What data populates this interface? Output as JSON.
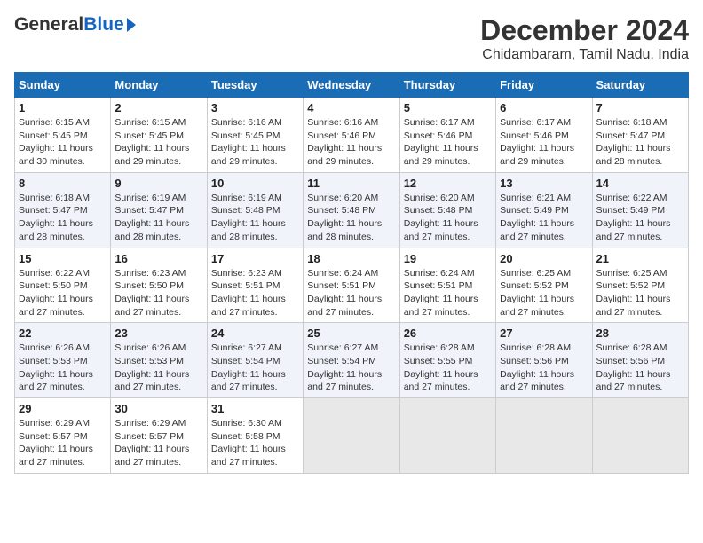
{
  "logo": {
    "general": "General",
    "blue": "Blue"
  },
  "title": "December 2024",
  "subtitle": "Chidambaram, Tamil Nadu, India",
  "days_of_week": [
    "Sunday",
    "Monday",
    "Tuesday",
    "Wednesday",
    "Thursday",
    "Friday",
    "Saturday"
  ],
  "weeks": [
    [
      {
        "day": "1",
        "info": "Sunrise: 6:15 AM\nSunset: 5:45 PM\nDaylight: 11 hours\nand 30 minutes."
      },
      {
        "day": "2",
        "info": "Sunrise: 6:15 AM\nSunset: 5:45 PM\nDaylight: 11 hours\nand 29 minutes."
      },
      {
        "day": "3",
        "info": "Sunrise: 6:16 AM\nSunset: 5:45 PM\nDaylight: 11 hours\nand 29 minutes."
      },
      {
        "day": "4",
        "info": "Sunrise: 6:16 AM\nSunset: 5:46 PM\nDaylight: 11 hours\nand 29 minutes."
      },
      {
        "day": "5",
        "info": "Sunrise: 6:17 AM\nSunset: 5:46 PM\nDaylight: 11 hours\nand 29 minutes."
      },
      {
        "day": "6",
        "info": "Sunrise: 6:17 AM\nSunset: 5:46 PM\nDaylight: 11 hours\nand 29 minutes."
      },
      {
        "day": "7",
        "info": "Sunrise: 6:18 AM\nSunset: 5:47 PM\nDaylight: 11 hours\nand 28 minutes."
      }
    ],
    [
      {
        "day": "8",
        "info": "Sunrise: 6:18 AM\nSunset: 5:47 PM\nDaylight: 11 hours\nand 28 minutes."
      },
      {
        "day": "9",
        "info": "Sunrise: 6:19 AM\nSunset: 5:47 PM\nDaylight: 11 hours\nand 28 minutes."
      },
      {
        "day": "10",
        "info": "Sunrise: 6:19 AM\nSunset: 5:48 PM\nDaylight: 11 hours\nand 28 minutes."
      },
      {
        "day": "11",
        "info": "Sunrise: 6:20 AM\nSunset: 5:48 PM\nDaylight: 11 hours\nand 28 minutes."
      },
      {
        "day": "12",
        "info": "Sunrise: 6:20 AM\nSunset: 5:48 PM\nDaylight: 11 hours\nand 27 minutes."
      },
      {
        "day": "13",
        "info": "Sunrise: 6:21 AM\nSunset: 5:49 PM\nDaylight: 11 hours\nand 27 minutes."
      },
      {
        "day": "14",
        "info": "Sunrise: 6:22 AM\nSunset: 5:49 PM\nDaylight: 11 hours\nand 27 minutes."
      }
    ],
    [
      {
        "day": "15",
        "info": "Sunrise: 6:22 AM\nSunset: 5:50 PM\nDaylight: 11 hours\nand 27 minutes."
      },
      {
        "day": "16",
        "info": "Sunrise: 6:23 AM\nSunset: 5:50 PM\nDaylight: 11 hours\nand 27 minutes."
      },
      {
        "day": "17",
        "info": "Sunrise: 6:23 AM\nSunset: 5:51 PM\nDaylight: 11 hours\nand 27 minutes."
      },
      {
        "day": "18",
        "info": "Sunrise: 6:24 AM\nSunset: 5:51 PM\nDaylight: 11 hours\nand 27 minutes."
      },
      {
        "day": "19",
        "info": "Sunrise: 6:24 AM\nSunset: 5:51 PM\nDaylight: 11 hours\nand 27 minutes."
      },
      {
        "day": "20",
        "info": "Sunrise: 6:25 AM\nSunset: 5:52 PM\nDaylight: 11 hours\nand 27 minutes."
      },
      {
        "day": "21",
        "info": "Sunrise: 6:25 AM\nSunset: 5:52 PM\nDaylight: 11 hours\nand 27 minutes."
      }
    ],
    [
      {
        "day": "22",
        "info": "Sunrise: 6:26 AM\nSunset: 5:53 PM\nDaylight: 11 hours\nand 27 minutes."
      },
      {
        "day": "23",
        "info": "Sunrise: 6:26 AM\nSunset: 5:53 PM\nDaylight: 11 hours\nand 27 minutes."
      },
      {
        "day": "24",
        "info": "Sunrise: 6:27 AM\nSunset: 5:54 PM\nDaylight: 11 hours\nand 27 minutes."
      },
      {
        "day": "25",
        "info": "Sunrise: 6:27 AM\nSunset: 5:54 PM\nDaylight: 11 hours\nand 27 minutes."
      },
      {
        "day": "26",
        "info": "Sunrise: 6:28 AM\nSunset: 5:55 PM\nDaylight: 11 hours\nand 27 minutes."
      },
      {
        "day": "27",
        "info": "Sunrise: 6:28 AM\nSunset: 5:56 PM\nDaylight: 11 hours\nand 27 minutes."
      },
      {
        "day": "28",
        "info": "Sunrise: 6:28 AM\nSunset: 5:56 PM\nDaylight: 11 hours\nand 27 minutes."
      }
    ],
    [
      {
        "day": "29",
        "info": "Sunrise: 6:29 AM\nSunset: 5:57 PM\nDaylight: 11 hours\nand 27 minutes."
      },
      {
        "day": "30",
        "info": "Sunrise: 6:29 AM\nSunset: 5:57 PM\nDaylight: 11 hours\nand 27 minutes."
      },
      {
        "day": "31",
        "info": "Sunrise: 6:30 AM\nSunset: 5:58 PM\nDaylight: 11 hours\nand 27 minutes."
      },
      {
        "day": "",
        "info": ""
      },
      {
        "day": "",
        "info": ""
      },
      {
        "day": "",
        "info": ""
      },
      {
        "day": "",
        "info": ""
      }
    ]
  ]
}
